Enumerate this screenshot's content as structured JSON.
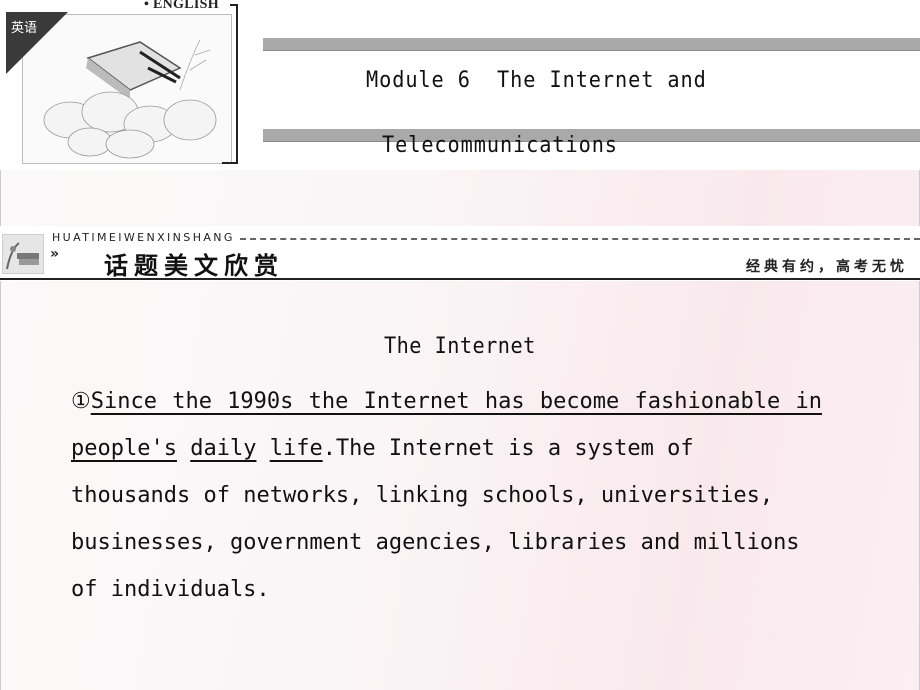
{
  "header": {
    "subject_tag": "英语",
    "brand_label": "• ENGLISH",
    "title_line1": "Module 6  The Internet and",
    "title_line2": "Telecommunications"
  },
  "section": {
    "pinyin": "HUATIMEIWENXINSHANG",
    "chevron": "»",
    "title": "话题美文欣赏",
    "slogan": "经典有约，高考无忧"
  },
  "passage": {
    "title": "The Internet",
    "marker": "①",
    "underlined_phrase_parts": [
      "Since the 1990s the Internet has become fashionable in",
      "people's",
      "daily",
      "life"
    ],
    "line2_rest": [
      ".The",
      "Internet",
      "is",
      "a",
      "system",
      "of"
    ],
    "line3": [
      "thousands",
      "of",
      "networks,",
      "linking",
      "schools,",
      "universities,"
    ],
    "line4": [
      "businesses,",
      "government",
      "agencies,",
      "libraries",
      "and",
      "millions"
    ],
    "line5": "of individuals."
  },
  "colors": {
    "title_bar": "#a9a9a9",
    "text": "#111111",
    "bg_tint": "#f9e9ee"
  }
}
